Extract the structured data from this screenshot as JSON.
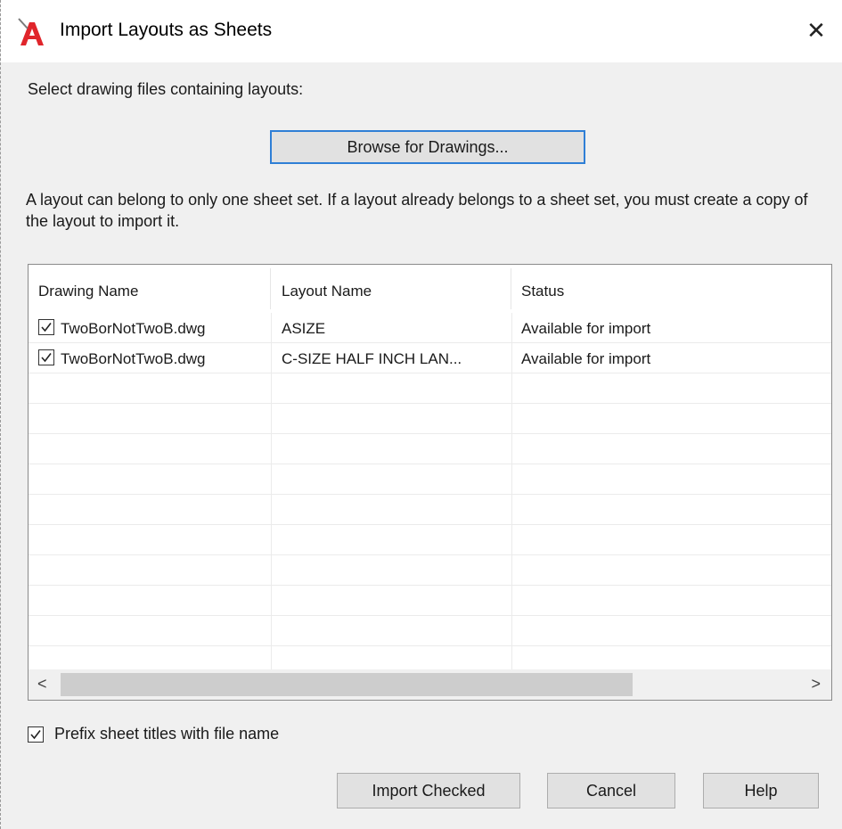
{
  "window": {
    "title": "Import Layouts as Sheets",
    "close_glyph": "✕",
    "accent_color": "#2f7fd6",
    "icon": "autocad-app-icon"
  },
  "instructions": "Select drawing files containing layouts:",
  "browse_button": "Browse for Drawings...",
  "note": "A layout can belong to only one sheet set. If a layout already belongs to a sheet set, you must create a copy of the layout to import it.",
  "table": {
    "columns": [
      "Drawing Name",
      "Layout Name",
      "Status"
    ],
    "rows": [
      {
        "checked": true,
        "drawing": "TwoBorNotTwoB.dwg",
        "layout": "ASIZE",
        "status": "Available for import"
      },
      {
        "checked": true,
        "drawing": "TwoBorNotTwoB.dwg",
        "layout": "C-SIZE HALF INCH LAN...",
        "status": "Available for import"
      }
    ],
    "scroll_left": "<",
    "scroll_right": ">"
  },
  "prefix_option": {
    "checked": true,
    "label": "Prefix sheet titles with file name"
  },
  "buttons": {
    "import": "Import Checked",
    "cancel": "Cancel",
    "help": "Help"
  }
}
